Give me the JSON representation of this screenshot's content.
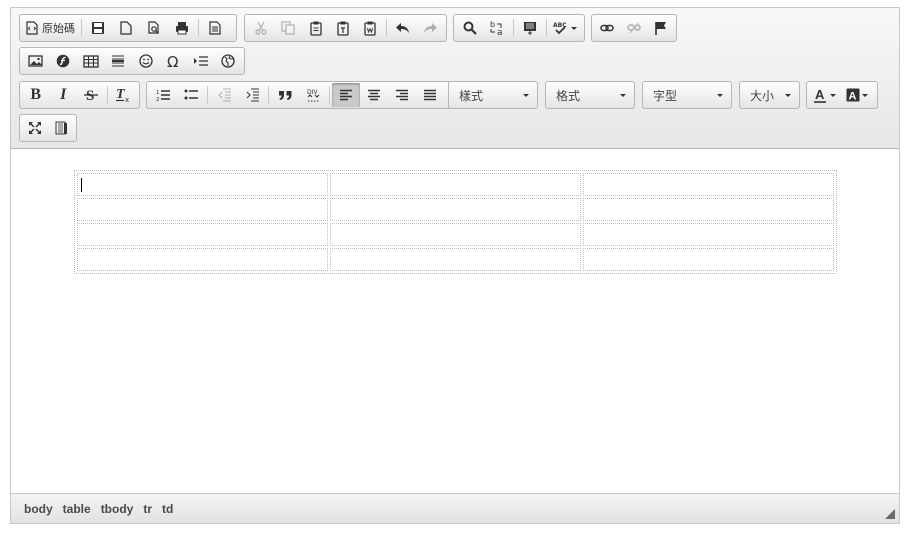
{
  "toolbar": {
    "source_label": "原始碼",
    "styles_label": "樣式",
    "format_label": "格式",
    "font_label": "字型",
    "size_label": "大小"
  },
  "statusbar": {
    "path": [
      "body",
      "table",
      "tbody",
      "tr",
      "td"
    ]
  },
  "table": {
    "rows": 4,
    "cols": 3
  }
}
